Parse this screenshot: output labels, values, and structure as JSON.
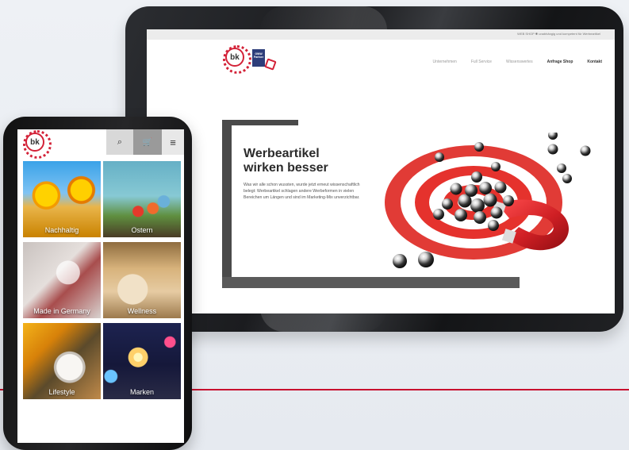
{
  "tablet_site": {
    "topbar_text": "WEB SHOP ✱  unabhängig und kompetent für Werbeartikel",
    "topbar_brand": "WEB SHOP",
    "logo_badge": "GWW Partner",
    "nav": [
      "Unternehmen",
      "Full Service",
      "Wissenswertes",
      "Anfrage Shop",
      "Kontakt"
    ],
    "hero_title": "Werbeartikel wirken besser",
    "hero_body": "Was wir alle schon wussten, wurde jetzt erneut wissenschaftlich belegt: Werbeartikel schlagen andere Werbeformen in vielen Bereichen um Längen und sind im Marketing-Mix unverzichtbar."
  },
  "phone_site": {
    "logo": "bk",
    "icons": {
      "search": "search-icon",
      "cart": "cart-icon",
      "menu": "menu-icon"
    },
    "tiles": [
      "Nachhaltig",
      "Ostern",
      "Made in Germany",
      "Wellness",
      "Lifestyle",
      "Marken"
    ]
  },
  "colors": {
    "accent_red": "#c8102e",
    "background": "#e9edf2"
  }
}
